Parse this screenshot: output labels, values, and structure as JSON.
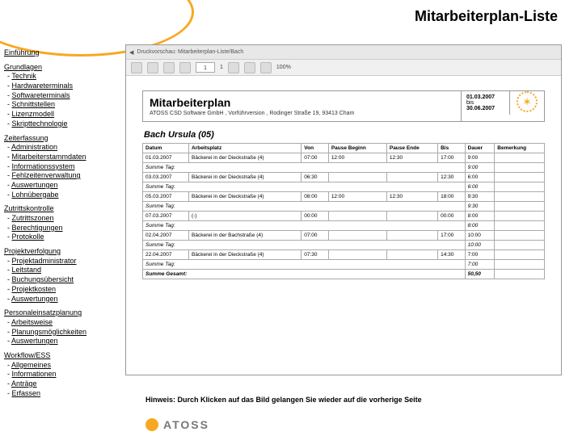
{
  "page_title": "Mitarbeiterplan-Liste",
  "nav": {
    "intro": "Einführung",
    "sections": [
      {
        "title": "Grundlagen",
        "items": [
          "Technik",
          "Hardwareterminals",
          "Softwareterminals",
          "Schnittstellen",
          "Lizenzmodell",
          "Skripttechnologie"
        ]
      },
      {
        "title": "Zeiterfassung",
        "items": [
          "Administration",
          "Mitarbeiterstammdaten",
          "Informationssystem",
          "Fehlzeitenverwaltung",
          "Auswertungen",
          "Lohnübergabe"
        ]
      },
      {
        "title": "Zutrittskontrolle",
        "items": [
          "Zutrittszonen",
          "Berechtigungen",
          "Protokolle"
        ]
      },
      {
        "title": "Projektverfolgung",
        "items": [
          "Projektadministrator",
          "Leitstand",
          "Buchungsübersicht",
          "Projektkosten",
          "Auswertungen"
        ]
      },
      {
        "title": "Personaleinsatzplanung",
        "items": [
          "Arbeitsweise",
          "Planungsmöglichkeiten",
          "Auswertungen"
        ]
      },
      {
        "title": "Workflow/ESS",
        "items": [
          "Allgemeines",
          "Informationen",
          "Anträge",
          "Erfassen"
        ]
      }
    ]
  },
  "preview": {
    "tab": "Druckvorschau: Mitarbeiterplan-Liste/Bach",
    "toolbar_page": "1",
    "toolbar_pages": "1",
    "toolbar_zoom": "100%"
  },
  "doc": {
    "title": "Mitarbeiterplan",
    "sub": "ATOSS CSD Software GmbH , Vorführversion , Rodinger Straße 19, 93413 Cham",
    "date_from": "01.03.2007",
    "date_sep": "bis",
    "date_to": "30.06.2007",
    "employee": "Bach Ursula (05)",
    "cols": [
      "Datum",
      "Arbeitsplatz",
      "Von",
      "Pause Beginn",
      "Pause Ende",
      "Bis",
      "Dauer",
      "Bemerkung"
    ],
    "rows": [
      {
        "d": "01.03.2007",
        "a": "Bäckerei in der Dieckstraße (4)",
        "v": "07:00",
        "pb": "12:00",
        "pe": "12:30",
        "b": "17:00",
        "du": "9:00",
        "be": ""
      },
      {
        "sum": "Summe Tag:",
        "du": "9:00"
      },
      {
        "d": "03.03.2007",
        "a": "Bäckerei in der Dieckstraße (4)",
        "v": "06:30",
        "pb": "",
        "pe": "",
        "b": "12:30",
        "du": "6:00",
        "be": ""
      },
      {
        "sum": "Summe Tag:",
        "du": "6:00"
      },
      {
        "d": "05.03.2007",
        "a": "Bäckerei in der Dieckstraße (4)",
        "v": "08:00",
        "pb": "12:00",
        "pe": "12:30",
        "b": "18:00",
        "du": "9:30",
        "be": ""
      },
      {
        "sum": "Summe Tag:",
        "du": "9:30"
      },
      {
        "d": "07.03.2007",
        "a": "(-)",
        "v": "00:00",
        "pb": "",
        "pe": "",
        "b": "00:00",
        "du": "8:00",
        "be": ""
      },
      {
        "sum": "Summe Tag:",
        "du": "8:00"
      },
      {
        "d": "02.04.2007",
        "a": "Bäckerei in der Bachstraße (4)",
        "v": "07:00",
        "pb": "",
        "pe": "",
        "b": "17:00",
        "du": "10:00",
        "be": ""
      },
      {
        "sum": "Summe Tag:",
        "du": "10:00"
      },
      {
        "d": "22.04.2007",
        "a": "Bäckerei in der Dieckstraße (4)",
        "v": "07:30",
        "pb": "",
        "pe": "",
        "b": "14:30",
        "du": "7:00",
        "be": ""
      },
      {
        "sum": "Summe Tag:",
        "du": "7:00"
      },
      {
        "grand": "Summe Gesamt:",
        "du": "50,50"
      }
    ]
  },
  "hint": "Hinweis: Durch Klicken auf das Bild gelangen Sie wieder auf die vorherige Seite",
  "footer": "ATOSS"
}
